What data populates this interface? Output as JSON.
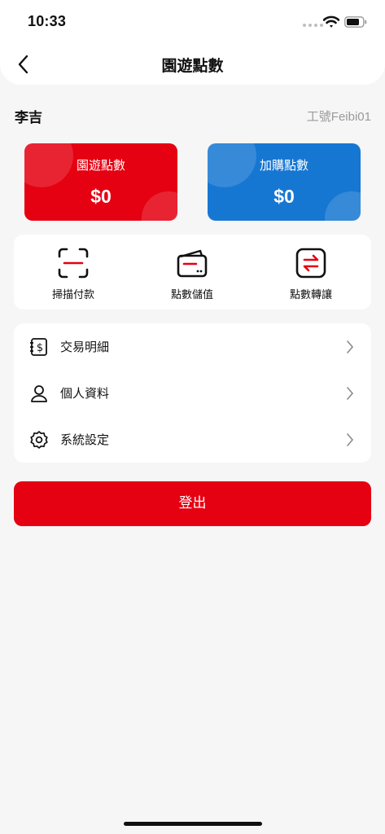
{
  "status_bar": {
    "time": "10:33"
  },
  "nav": {
    "title": "園遊點數",
    "back_icon": "chevron-left-icon"
  },
  "user": {
    "name": "李吉",
    "employee_id": "工號Feibi01"
  },
  "cards": [
    {
      "label": "園遊點數",
      "value": "$0",
      "color": "#e50012"
    },
    {
      "label": "加購點數",
      "value": "$0",
      "color": "#1677d2"
    }
  ],
  "actions": [
    {
      "label": "掃描付款",
      "icon": "scan-icon"
    },
    {
      "label": "點數儲值",
      "icon": "wallet-icon"
    },
    {
      "label": "點數轉讓",
      "icon": "transfer-icon"
    }
  ],
  "menu": [
    {
      "label": "交易明細",
      "icon": "receipt-icon"
    },
    {
      "label": "個人資料",
      "icon": "user-icon"
    },
    {
      "label": "系統設定",
      "icon": "settings-icon"
    }
  ],
  "logout": {
    "label": "登出",
    "color": "#e50012"
  },
  "accent_color": "#e50012"
}
